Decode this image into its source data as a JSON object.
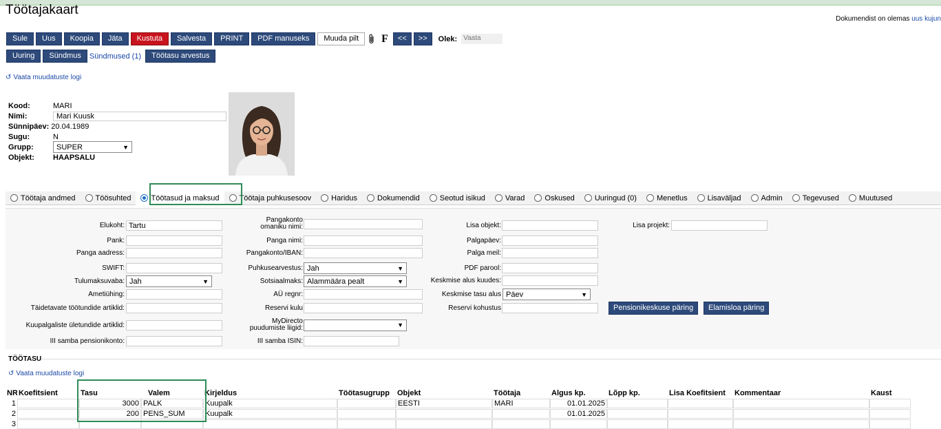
{
  "page": {
    "title": "Töötajakaart",
    "doc_note_prefix": "Dokumendist on olemas",
    "doc_note_link": "uus kujun"
  },
  "toolbar": {
    "sule": "Sule",
    "uus": "Uus",
    "koopia": "Koopia",
    "jata": "Jäta",
    "kustuta": "Kustuta",
    "salvesta": "Salvesta",
    "print": "PRINT",
    "pdf": "PDF manuseks",
    "muuda_pilt": "Muuda pilt",
    "f": "F",
    "prev": "<<",
    "next": ">>",
    "olek_label": "Olek:",
    "olek_value": "Vaata"
  },
  "toolbar2": {
    "uuring": "Uuring",
    "sundmus": "Sündmus",
    "sundmused": "Sündmused (1)",
    "tootasu_arvestus": "Töötasu arvestus"
  },
  "log_link": "Vaata muudatuste logi",
  "employee": {
    "kood_label": "Kood:",
    "kood": "MARI",
    "nimi_label": "Nimi:",
    "nimi": "Mari Kuusk",
    "sunnipaev_label": "Sünnipäev:",
    "sunnipaev": "20.04.1989",
    "sugu_label": "Sugu:",
    "sugu": "N",
    "grupp_label": "Grupp:",
    "grupp": "SUPER",
    "objekt_label": "Objekt:",
    "objekt": "HAAPSALU"
  },
  "tabs": [
    {
      "label": "Töötaja andmed"
    },
    {
      "label": "Töösuhted"
    },
    {
      "label": "Töötasud ja maksud"
    },
    {
      "label": "Töötaja puhkusesoov"
    },
    {
      "label": "Haridus"
    },
    {
      "label": "Dokumendid"
    },
    {
      "label": "Seotud isikud"
    },
    {
      "label": "Varad"
    },
    {
      "label": "Oskused"
    },
    {
      "label": "Uuringud (0)"
    },
    {
      "label": "Menetlus"
    },
    {
      "label": "Lisaväljad"
    },
    {
      "label": "Admin"
    },
    {
      "label": "Tegevused"
    },
    {
      "label": "Muutused"
    }
  ],
  "form": {
    "elukoht_label": "Elukoht:",
    "elukoht": "Tartu",
    "pank_label": "Pank:",
    "panga_aadress_label": "Panga aadress:",
    "swift_label": "SWIFT:",
    "tulumaksuvaba_label": "Tulumaksuvaba:",
    "tulumaksuvaba": "Jah",
    "ametiuhing_label": "Ametiühing:",
    "taidetavate_label": "Täidetavate töötundide artiklid:",
    "kuupalgaliste_label": "Kuupalgaliste ületundide artiklid:",
    "iii_samba_label": "III samba pensionikonto:",
    "pangakonto_omaniku_label1": "Pangakonto",
    "pangakonto_omaniku_label2": "omaniku nimi:",
    "panga_nimi_label": "Panga nimi:",
    "pangakonto_iban_label": "Pangakonto/IBAN:",
    "puhkusearvestus_label": "Puhkusearvestus:",
    "puhkusearvestus": "Jah",
    "sotsiaalmaks_label": "Sotsiaalmaks:",
    "sotsiaalmaks": "Alammäära pealt",
    "au_regnr_label": "AÜ regnr:",
    "reservi_kulu_label": "Reservi kulu",
    "mydirecto_label1": "MyDirecto",
    "mydirecto_label2": "puudumiste liigid:",
    "iii_samba_isin_label": "III samba ISIN:",
    "lisa_objekt_label": "Lisa objekt:",
    "palgapaev_label": "Palgapäev:",
    "palga_meil_label": "Palga meil:",
    "pdf_parool_label": "PDF parool:",
    "keskmise_alus_label": "Keskmise alus kuudes:",
    "keskmise_tasu_label": "Keskmise tasu alus",
    "keskmise_tasu": "Päev",
    "reservi_kohustus_label": "Reservi kohustus",
    "lisa_projekt_label": "Lisa projekt:",
    "pension_btn": "Pensionikeskuse päring",
    "elamisloa_btn": "Elamisloa päring"
  },
  "salary": {
    "section_title": "TÖÖTASU",
    "columns": [
      "NR",
      "Koefitsient",
      "Tasu",
      "Valem",
      "Kirjeldus",
      "Töötasugrupp",
      "Objekt",
      "Töötaja",
      "Algus kp.",
      "Lõpp kp.",
      "Lisa Koefitsient",
      "Kommentaar",
      "Kaust"
    ],
    "rows": [
      {
        "nr": "1",
        "tasu": "3000",
        "valem": "PALK",
        "kirjeldus": "Kuupalk",
        "objekt": "EESTI",
        "tootaja": "MARI",
        "algus": "01.01.2025"
      },
      {
        "nr": "2",
        "tasu": "200",
        "valem": "PENS_SUM",
        "kirjeldus": "Kuupalk",
        "objekt": "",
        "tootaja": "",
        "algus": "01.01.2025"
      },
      {
        "nr": "3",
        "tasu": "",
        "valem": "",
        "kirjeldus": "",
        "objekt": "",
        "tootaja": "",
        "algus": ""
      }
    ]
  }
}
